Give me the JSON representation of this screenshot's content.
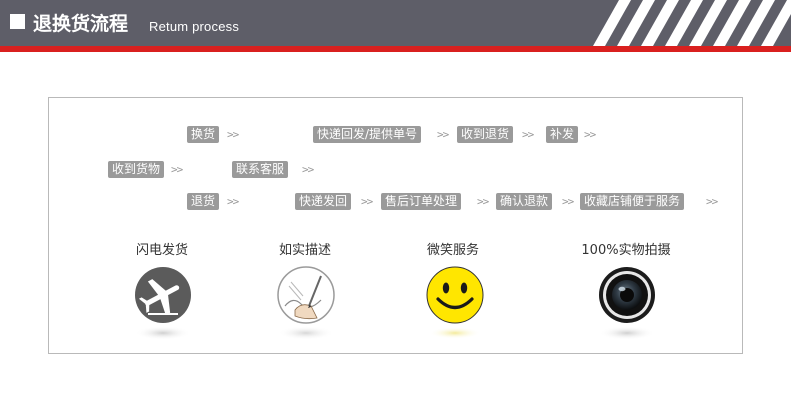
{
  "header": {
    "title": "退换货流程",
    "subtitle": "Retum process"
  },
  "colors": {
    "header_bg": "#5e5e68",
    "accent_red": "#d9201f",
    "chip_bg": "#9a9a9a",
    "smiley_yellow": "#ffe600"
  },
  "process": {
    "arrow": ">>",
    "exchange": {
      "step1": "换货",
      "step2": "快递回发/提供单号",
      "step3": "收到退货",
      "step4": "补发"
    },
    "received": {
      "step1": "收到货物",
      "step2": "联系客服"
    },
    "return": {
      "step1": "退货",
      "step2": "快递发回",
      "step3": "售后订单处理",
      "step4": "确认退款",
      "step5": "收藏店铺便于服务"
    }
  },
  "features": [
    {
      "label": "闪电发货",
      "icon": "airplane-icon"
    },
    {
      "label": "如实描述",
      "icon": "pen-writing-icon"
    },
    {
      "label": "微笑服务",
      "icon": "smiley-icon"
    },
    {
      "label": "100%实物拍摄",
      "icon": "camera-lens-icon"
    }
  ]
}
